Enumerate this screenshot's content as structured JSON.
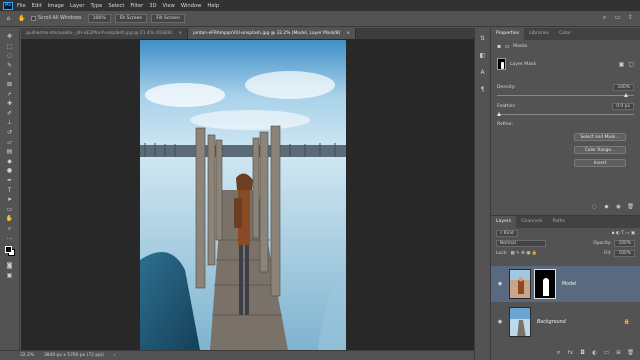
{
  "app": {
    "logo": "Ps"
  },
  "menu": [
    "File",
    "Edit",
    "Image",
    "Layer",
    "Type",
    "Select",
    "Filter",
    "3D",
    "View",
    "Window",
    "Help"
  ],
  "options": {
    "scroll_all_windows": "Scroll All Windows",
    "zoom_100": "100%",
    "fit_screen": "Fit Screen",
    "fill_screen": "Fill Screen"
  },
  "tabs": [
    {
      "label": "guilherme-stecanella-_dH-oE2Pha-Y-unsplash.jpg @ 21.4% (RGB/8)",
      "active": false
    },
    {
      "label": "jordan-eFRAmpqnVIU-unsplash.jpg @ 32.2% (Model, Layer Mask/8)",
      "active": true
    }
  ],
  "status": {
    "zoom": "32.2%",
    "doc_size": "3840 px x 5760 px (72 ppi)"
  },
  "properties": {
    "tabs": [
      "Properties",
      "Libraries",
      "Color"
    ],
    "section": "Masks",
    "mask_label": "Layer Mask",
    "density_label": "Density:",
    "density_value": "100%",
    "feather_label": "Feather:",
    "feather_value": "0.0 px",
    "refine_label": "Refine:",
    "buttons": [
      "Select and Mask...",
      "Color Range...",
      "Invert"
    ]
  },
  "layers": {
    "tabs": [
      "Layers",
      "Channels",
      "Paths"
    ],
    "kind": "Kind",
    "blend_mode": "Normal",
    "opacity_label": "Opacity:",
    "opacity_value": "100%",
    "lock_label": "Lock:",
    "fill_label": "Fill:",
    "fill_value": "100%",
    "items": [
      {
        "name": "Model",
        "selected": true
      },
      {
        "name": "Background",
        "selected": false
      }
    ]
  },
  "colors": {
    "accent": "#31a8ff",
    "selected_layer": "#596a80",
    "canvas_bg": "#282828"
  }
}
